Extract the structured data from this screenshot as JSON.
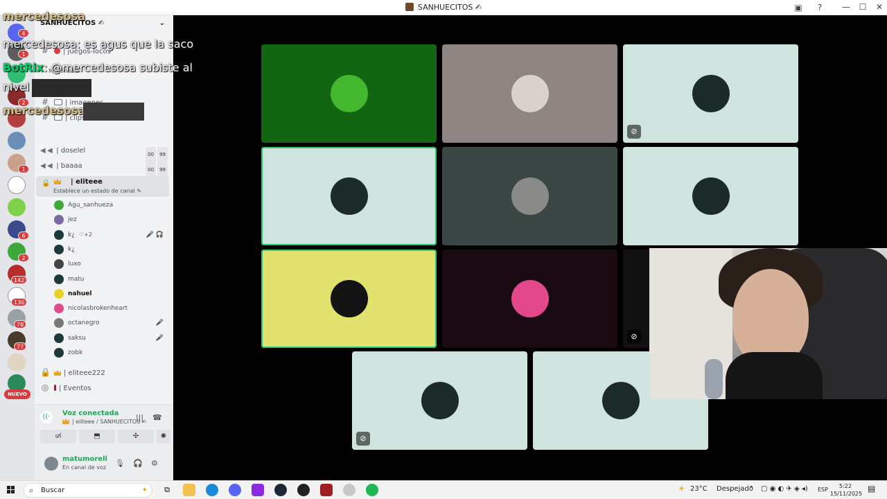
{
  "window": {
    "title": "SANHUECITOS ✍"
  },
  "server": {
    "name": "SANHUECITOS ✍"
  },
  "server_badges": [
    "4",
    "1",
    "1",
    "2",
    "1",
    "6",
    "2",
    "142",
    "136",
    "78",
    "77",
    "NUEVO"
  ],
  "channels": {
    "text": [
      {
        "label": "| juegos-locos"
      },
      {
        "label": "Multimedia"
      },
      {
        "label": "| imagenes"
      },
      {
        "label": "| clips"
      }
    ],
    "voice": [
      {
        "label": "| doselel",
        "limit_a": "00",
        "limit_b": "99"
      },
      {
        "label": "| baaaa",
        "limit_a": "00",
        "limit_b": "99"
      }
    ],
    "active": {
      "label": "| eliteee",
      "status": "Establece un estado de canal ✎"
    },
    "other": [
      {
        "label": "| eliteee222"
      },
      {
        "label": "| Eventos"
      }
    ]
  },
  "members": [
    {
      "name": "Agu_sanhueza",
      "color": "#3fa83b",
      "muted": ""
    },
    {
      "name": "jez",
      "color": "#7a6aa0",
      "muted": ""
    },
    {
      "name": "k¿",
      "color": "#1d3a3a",
      "muted": "🎤̸ 🎧̸",
      "extra": "♡+2"
    },
    {
      "name": "k¿",
      "color": "#1d3a3a",
      "muted": ""
    },
    {
      "name": "luxo",
      "color": "#444",
      "muted": ""
    },
    {
      "name": "matu",
      "color": "#1d3a3a",
      "muted": ""
    },
    {
      "name": "nahuel",
      "color": "#e8d22a",
      "muted": ""
    },
    {
      "name": "nicolasbrokenheart",
      "color": "#e24a8e",
      "muted": ""
    },
    {
      "name": "octanegro",
      "color": "#777",
      "muted": "🎤̸"
    },
    {
      "name": "saksu",
      "color": "#1d3a3a",
      "muted": "🎤̸"
    },
    {
      "name": "zobk",
      "color": "#1d3a3a",
      "muted": ""
    }
  ],
  "voice_panel": {
    "title": "Voz conectada",
    "sub": "| eliteee / SANHUECITOS ✍"
  },
  "user": {
    "name": "matumorell",
    "status": "En canal de voz"
  },
  "overlay": {
    "line1_name": "mercedesosa",
    "line2": "mercedesosa: es agus que la saco",
    "line3_bot": "BotRix",
    "line3_text": ": @mercedesosa subiste al",
    "line4": "nivel",
    "line5_name": "mercedesosa"
  },
  "tiles": [
    {
      "bg": "#126511",
      "avatar": "#43b82e",
      "speaking": false,
      "muted": false
    },
    {
      "bg": "#8e8583",
      "avatar": "#d7d2cb",
      "speaking": false,
      "muted": false
    },
    {
      "bg": "#cfe4df",
      "avatar": "#1d2a2a",
      "speaking": false,
      "muted": true
    },
    {
      "bg": "#cfe4df",
      "avatar": "#1d2a2a",
      "speaking": true,
      "muted": false
    },
    {
      "bg": "#3a4744",
      "avatar": "#8a8a88",
      "speaking": false,
      "muted": false
    },
    {
      "bg": "#cfe4df",
      "avatar": "#1d2a2a",
      "speaking": false,
      "muted": false
    },
    {
      "bg": "#e2e26f",
      "avatar": "#141414",
      "speaking": true,
      "muted": false
    },
    {
      "bg": "#1a0b12",
      "avatar": "#e2488b",
      "speaking": false,
      "muted": false
    },
    {
      "bg": "#111111",
      "avatar": "#111111",
      "speaking": false,
      "muted": true
    },
    {
      "bg": "#cfe4df",
      "avatar": "#1d2a2a",
      "speaking": false,
      "muted": true
    },
    {
      "bg": "#cfe4df",
      "avatar": "#1d2a2a",
      "speaking": false,
      "muted": false
    }
  ],
  "taskbar": {
    "search": "Buscar",
    "weather_temp": "23°C",
    "weather_desc": "Despejado",
    "lang": "ESP",
    "time": "5:22",
    "date": "15/11/2025"
  },
  "colors": {
    "speaking": "#2dc770",
    "voice_connected": "#23a55a",
    "badge": "#d83c3e"
  }
}
